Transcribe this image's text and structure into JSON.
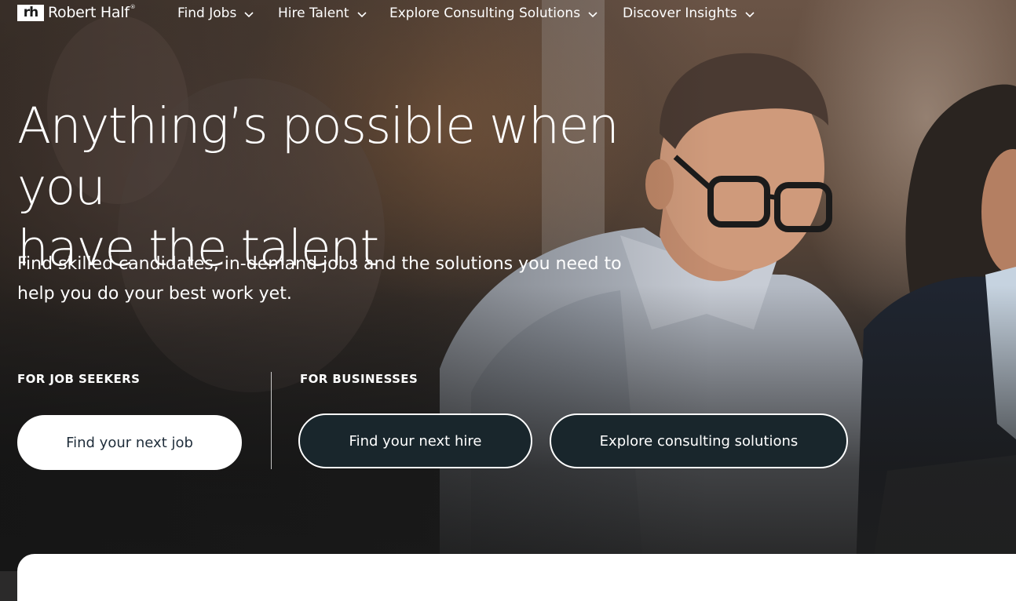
{
  "brand": {
    "logo_mark": "rh",
    "name": "Robert Half",
    "trademark": "®"
  },
  "nav": {
    "items": [
      {
        "label": "Find Jobs",
        "icon": "chevron-down-icon"
      },
      {
        "label": "Hire Talent",
        "icon": "chevron-down-icon"
      },
      {
        "label": "Explore Consulting Solutions",
        "icon": "chevron-down-icon"
      },
      {
        "label": "Discover Insights",
        "icon": "chevron-down-icon"
      }
    ]
  },
  "hero": {
    "headline_line1": "Anything’s possible when you",
    "headline_line2": "have the talent",
    "subtext_line1": "Find skilled candidates, in-demand jobs and the solutions you need to",
    "subtext_line2": "help you do your best work yet."
  },
  "job_seekers": {
    "label": "FOR JOB SEEKERS",
    "button_label": "Find your next job"
  },
  "businesses": {
    "label": "FOR BUSINESSES",
    "hire_button_label": "Find your next hire",
    "consulting_button_label": "Explore consulting solutions"
  },
  "colors": {
    "dark_button": "#19262c",
    "light_button_text": "#1f2d3a",
    "page_bottom": "#232323"
  }
}
